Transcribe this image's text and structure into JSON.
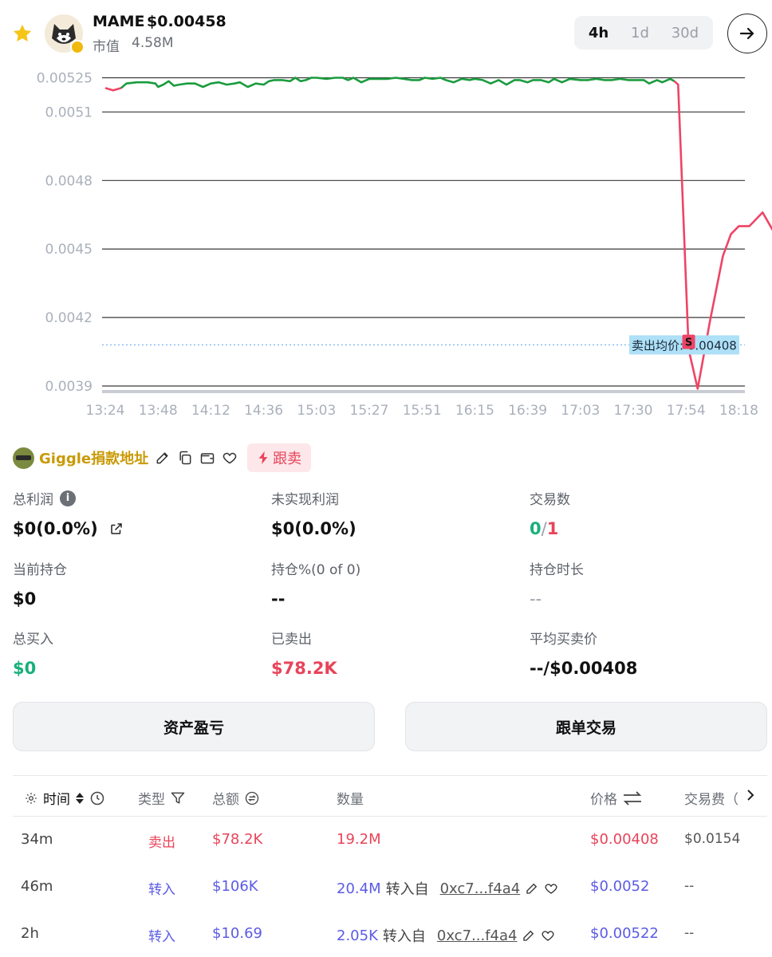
{
  "header": {
    "token_name": "MAME",
    "token_price": "$0.00458",
    "mcap_label": "市值",
    "mcap_value": "4.58M",
    "timeframes": [
      "4h",
      "1d",
      "30d"
    ],
    "active_timeframe": "4h"
  },
  "chart_data": {
    "type": "line",
    "y_ticks": [
      "0.00525",
      "0.0051",
      "0.0048",
      "0.0045",
      "0.0042",
      "0.0039"
    ],
    "y_tick_values": [
      0.00525,
      0.0051,
      0.0048,
      0.0045,
      0.0042,
      0.0039
    ],
    "x_ticks": [
      "13:24",
      "13:48",
      "14:12",
      "14:36",
      "15:03",
      "15:27",
      "15:51",
      "16:15",
      "16:39",
      "17:03",
      "17:30",
      "17:54",
      "18:18"
    ],
    "ylim": [
      0.00387,
      0.00526
    ],
    "grid": true,
    "avg_sell_line": {
      "label": "卖出均价: 0.00408",
      "value": 0.00408
    },
    "sell_marker": {
      "label": "S",
      "x_index": 11.05,
      "value": 0.00409
    },
    "green_color": "#1a9c3e",
    "red_color": "#ee4466",
    "series": [
      {
        "color": "#ee4466",
        "points": [
          [
            0,
            0.005205
          ],
          [
            0.15,
            0.005195
          ],
          [
            0.3,
            0.005205
          ]
        ]
      },
      {
        "color": "#1a9c3e",
        "points": [
          [
            0.3,
            0.005205
          ],
          [
            0.4,
            0.005225
          ],
          [
            0.6,
            0.00523
          ],
          [
            0.8,
            0.00523
          ],
          [
            0.95,
            0.005225
          ],
          [
            1.0,
            0.00521
          ],
          [
            1.1,
            0.00522
          ],
          [
            1.2,
            0.005235
          ],
          [
            1.3,
            0.005215
          ],
          [
            1.4,
            0.00522
          ],
          [
            1.55,
            0.005225
          ],
          [
            1.7,
            0.005225
          ],
          [
            1.85,
            0.00521
          ],
          [
            2.0,
            0.005225
          ],
          [
            2.15,
            0.00523
          ],
          [
            2.3,
            0.00522
          ],
          [
            2.45,
            0.005225
          ],
          [
            2.55,
            0.00523
          ],
          [
            2.7,
            0.00521
          ],
          [
            2.85,
            0.005225
          ],
          [
            3.0,
            0.00522
          ],
          [
            3.1,
            0.005235
          ],
          [
            3.2,
            0.00524
          ],
          [
            3.35,
            0.00524
          ],
          [
            3.5,
            0.005235
          ],
          [
            3.6,
            0.00525
          ],
          [
            3.7,
            0.005235
          ],
          [
            3.8,
            0.00524
          ],
          [
            3.9,
            0.00525
          ],
          [
            4.0,
            0.00525
          ],
          [
            4.2,
            0.005245
          ],
          [
            4.35,
            0.00525
          ],
          [
            4.5,
            0.00525
          ],
          [
            4.6,
            0.00524
          ],
          [
            4.7,
            0.00525
          ],
          [
            4.85,
            0.00523
          ],
          [
            5.0,
            0.005245
          ],
          [
            5.2,
            0.005245
          ],
          [
            5.35,
            0.005245
          ],
          [
            5.5,
            0.00525
          ],
          [
            5.65,
            0.005245
          ],
          [
            5.8,
            0.00524
          ],
          [
            5.95,
            0.00524
          ],
          [
            6.05,
            0.00525
          ],
          [
            6.2,
            0.005245
          ],
          [
            6.35,
            0.00525
          ],
          [
            6.45,
            0.00524
          ],
          [
            6.6,
            0.00523
          ],
          [
            6.75,
            0.005245
          ],
          [
            6.9,
            0.00524
          ],
          [
            7.0,
            0.005245
          ],
          [
            7.15,
            0.00524
          ],
          [
            7.3,
            0.005225
          ],
          [
            7.45,
            0.00524
          ],
          [
            7.6,
            0.00522
          ],
          [
            7.75,
            0.00524
          ],
          [
            7.85,
            0.00524
          ],
          [
            8.0,
            0.00523
          ],
          [
            8.1,
            0.00524
          ],
          [
            8.25,
            0.00524
          ],
          [
            8.4,
            0.00523
          ],
          [
            8.5,
            0.005245
          ],
          [
            8.65,
            0.00523
          ],
          [
            8.8,
            0.005245
          ],
          [
            9.0,
            0.00524
          ],
          [
            9.15,
            0.00524
          ],
          [
            9.3,
            0.005245
          ],
          [
            9.45,
            0.00524
          ],
          [
            9.6,
            0.00524
          ],
          [
            9.75,
            0.005245
          ],
          [
            9.9,
            0.00524
          ],
          [
            10.0,
            0.00524
          ],
          [
            10.1,
            0.00524
          ],
          [
            10.2,
            0.00524
          ],
          [
            10.3,
            0.005225
          ],
          [
            10.45,
            0.00524
          ],
          [
            10.55,
            0.00523
          ],
          [
            10.7,
            0.005245
          ],
          [
            10.78,
            0.005235
          ]
        ]
      },
      {
        "color": "#ee4466",
        "points": [
          [
            10.78,
            0.005235
          ],
          [
            10.85,
            0.00522
          ],
          [
            11.05,
            0.00406
          ],
          [
            11.22,
            0.003888
          ],
          [
            11.45,
            0.00418
          ],
          [
            11.7,
            0.00447
          ],
          [
            11.85,
            0.004565
          ],
          [
            12.0,
            0.0046
          ],
          [
            12.2,
            0.0046
          ],
          [
            12.45,
            0.00466
          ],
          [
            12.65,
            0.00458
          ]
        ]
      }
    ]
  },
  "wallet": {
    "name": "Giggle捐款地址",
    "follow_label": "跟卖"
  },
  "stats": {
    "total_profit_label": "总利润",
    "total_profit_value": "$0(0.0%)",
    "unrealized_label": "未实现利润",
    "unrealized_value": "$0(0.0%)",
    "tx_count_label": "交易数",
    "tx_buy": "0",
    "tx_sep": "/",
    "tx_sell": "1",
    "holding_label": "当前持仓",
    "holding_value": "$0",
    "holding_pct_label": "持仓%(0 of 0)",
    "holding_pct_value": "--",
    "holding_duration_label": "持仓时长",
    "holding_duration_value": "--",
    "total_buy_label": "总买入",
    "total_buy_value": "$0",
    "sold_label": "已卖出",
    "sold_value": "$78.2K",
    "avg_price_label": "平均买卖价",
    "avg_price_value": "--/$0.00408"
  },
  "buttons": {
    "asset_pnl": "资产盈亏",
    "copy_trade": "跟单交易"
  },
  "table": {
    "headers": {
      "time": "时间",
      "type": "类型",
      "total": "总额",
      "amount": "数量",
      "price": "价格",
      "fee": "交易费（"
    },
    "rows": [
      {
        "time": "34m",
        "type": "卖出",
        "type_kind": "sell",
        "total": "$78.2K",
        "amount": "19.2M",
        "from_label": "",
        "from_addr": "",
        "price": "$0.00408",
        "fee": "$0.0154"
      },
      {
        "time": "46m",
        "type": "转入",
        "type_kind": "in",
        "total": "$106K",
        "amount": "20.4M",
        "from_label": "转入自",
        "from_addr": "0xc7...f4a4",
        "price": "$0.0052",
        "fee": "--"
      },
      {
        "time": "2h",
        "type": "转入",
        "type_kind": "in",
        "total": "$10.69",
        "amount": "2.05K",
        "from_label": "转入自",
        "from_addr": "0xc7...f4a4",
        "price": "$0.00522",
        "fee": "--"
      }
    ]
  }
}
